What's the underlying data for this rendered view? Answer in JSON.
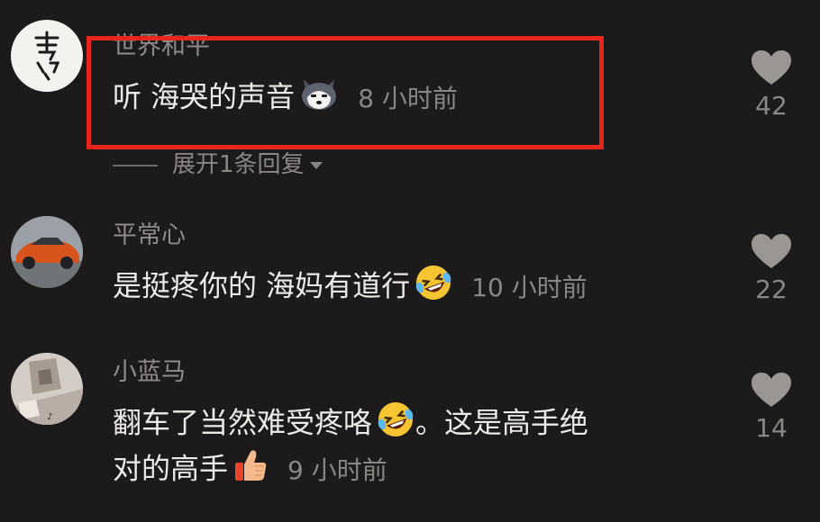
{
  "comments": [
    {
      "username": "世界和平",
      "text": "听 海哭的声音",
      "emoji": "husky-emoji",
      "time": "8 小时前",
      "likes": "42",
      "avatar": "calligraphy-avatar",
      "highlighted": true,
      "replies_toggle": "展开1条回复"
    },
    {
      "username": "平常心",
      "text": "是挺疼你的 海妈有道行",
      "emoji": "rofl-emoji",
      "time": "10 小时前",
      "likes": "22",
      "avatar": "orange-car-avatar"
    },
    {
      "username": "小蓝马",
      "text_line1": "翻车了当然难受疼咯",
      "emoji": "rofl-emoji",
      "text_line1_tail": "。这是高手绝",
      "text_line2": "对的高手",
      "emoji2": "thumbs-up-emoji",
      "time": "9 小时前",
      "likes": "14",
      "avatar": "photo-avatar"
    }
  ],
  "colors": {
    "background": "#1c1a1a",
    "highlight": "#e8261e",
    "heart": "#9a9693"
  }
}
